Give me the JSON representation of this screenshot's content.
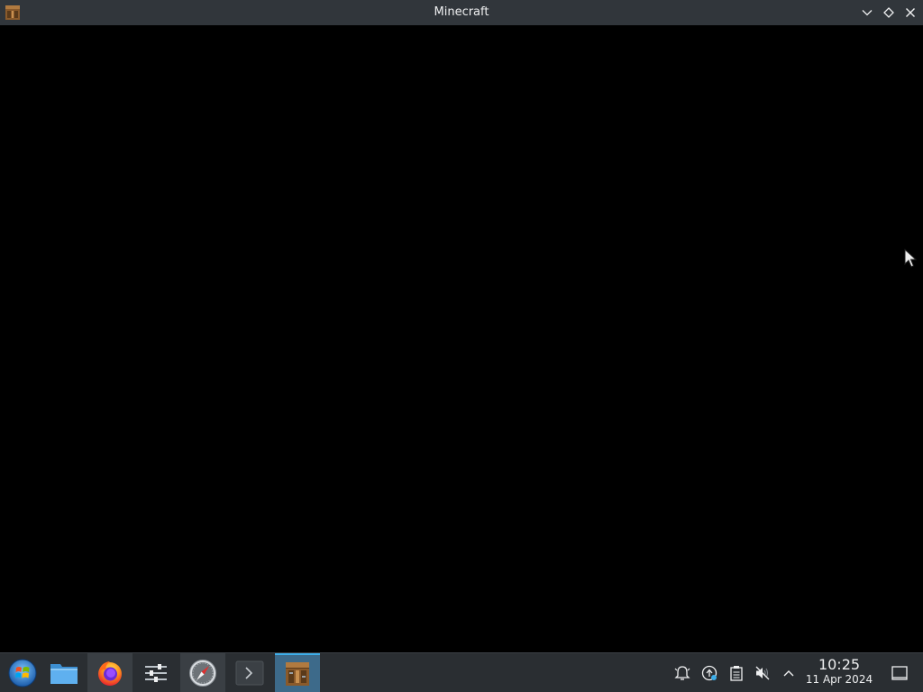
{
  "window": {
    "title": "Minecraft",
    "icon": "crafting-table-icon",
    "controls": [
      "minimize-icon",
      "maximize-icon",
      "close-icon"
    ]
  },
  "taskbar": {
    "launcher_icon": "start-orb-icon",
    "apps": [
      {
        "name": "file-manager-icon",
        "state": "pinned"
      },
      {
        "name": "firefox-icon",
        "state": "open"
      },
      {
        "name": "system-settings-icon",
        "state": "pinned"
      },
      {
        "name": "safari-compass-icon",
        "state": "open"
      },
      {
        "name": "terminal-icon",
        "state": "pinned"
      },
      {
        "name": "minecraft-icon",
        "state": "active"
      }
    ],
    "tray": [
      "notifications-bell-icon",
      "update-icon",
      "clipboard-icon",
      "volume-muted-icon",
      "expand-tray-chevron-icon"
    ],
    "clock": {
      "time": "10:25",
      "date": "11 Apr 2024"
    },
    "show_desktop_icon": "show-desktop-icon"
  },
  "colors": {
    "titlebar": "#31363b",
    "taskbar": "#2a2e32",
    "active_task": "#3d6a8a",
    "accent": "#3daee9",
    "content": "#000000"
  }
}
